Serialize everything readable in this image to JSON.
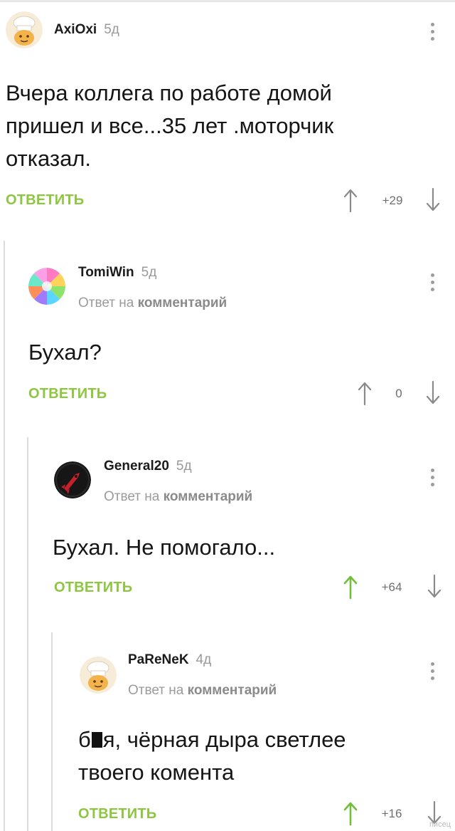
{
  "colors": {
    "accent_green": "#8dc63f",
    "muted": "#9b9b9b",
    "arrow": "#8a8a8a"
  },
  "comments": [
    {
      "user": "AxiOxi",
      "age": "5д",
      "reply_prefix": "",
      "reply_target": "",
      "text_lines": [
        "Вчера коллега по работе домой",
        "пришел и все...35 лет .моторчик",
        "отказал."
      ],
      "reply_label": "ОТВЕТИТЬ",
      "score": "+29",
      "avatar": "chef-avatar-icon",
      "upvoted": false
    },
    {
      "user": "TomiWin",
      "age": "5д",
      "reply_prefix": "Ответ на",
      "reply_target": "комментарий",
      "text_lines": [
        "Бухал?"
      ],
      "reply_label": "ОТВЕТИТЬ",
      "score": "0",
      "avatar": "rainbow-avatar-icon",
      "upvoted": false
    },
    {
      "user": "General20",
      "age": "5д",
      "reply_prefix": "Ответ на",
      "reply_target": "комментарий",
      "text_lines": [
        "Бухал. Не помогало..."
      ],
      "reply_label": "ОТВЕТИТЬ",
      "score": "+64",
      "avatar": "rocket-avatar-icon",
      "upvoted": true
    },
    {
      "user": "PaReNeK",
      "age": "4д",
      "reply_prefix": "Ответ на",
      "reply_target": "комментарий",
      "text_lines_first_start": "б",
      "text_lines_first_end": "я, чёрная дыра светлее",
      "text_lines": [
        "твоего комента"
      ],
      "reply_label": "ОТВЕТИТЬ",
      "score": "+16",
      "avatar": "chef-avatar-icon",
      "upvoted": true
    }
  ],
  "watermark": "писец"
}
